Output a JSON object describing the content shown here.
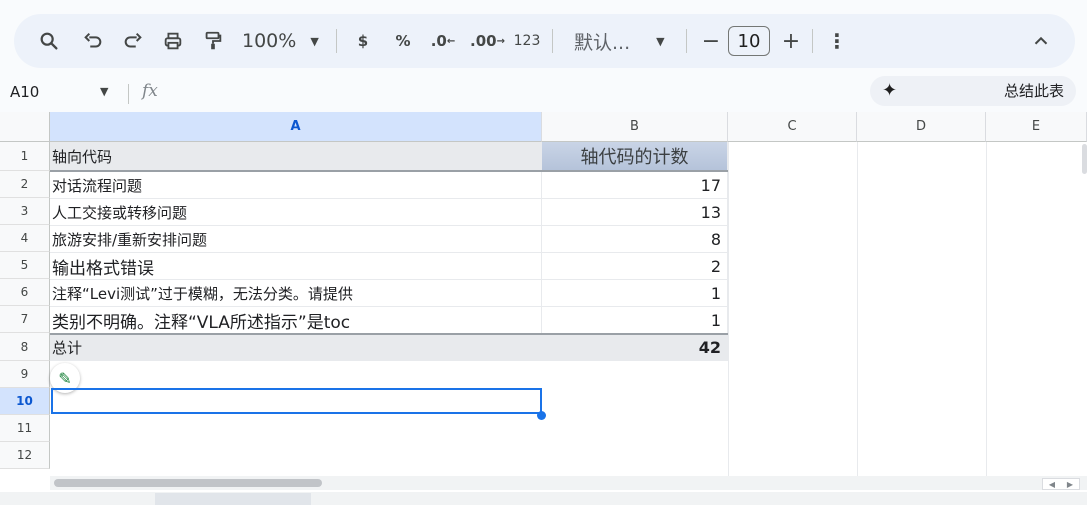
{
  "toolbar": {
    "zoom": "100%",
    "currency": "$",
    "percent": "%",
    "dec_decrease": ".0",
    "dec_increase": ".00",
    "format_123": "123",
    "font": "默认...",
    "minus": "−",
    "font_size": "10",
    "plus": "+",
    "more": "⋮",
    "collapse": "︿"
  },
  "formula_bar": {
    "cell_ref": "A10",
    "fx": "fx",
    "summarize_label": "总结此表"
  },
  "columns": [
    "A",
    "B",
    "C",
    "D",
    "E"
  ],
  "rows": [
    "1",
    "2",
    "3",
    "4",
    "5",
    "6",
    "7",
    "8",
    "9",
    "10",
    "11",
    "12"
  ],
  "table": {
    "header_a": "轴向代码",
    "header_b": "轴代码的计数",
    "items": [
      {
        "label": "对话流程问题",
        "count": "17"
      },
      {
        "label": "人工交接或转移问题",
        "count": "13"
      },
      {
        "label": "旅游安排/重新安排问题",
        "count": "8"
      },
      {
        "label": "输出格式错误",
        "count": "2"
      },
      {
        "label": "注释“Levi测试”过于模糊，无法分类。请提供",
        "count": "1"
      },
      {
        "label": "类别不明确。注释“VLA所述指示”是toc",
        "count": "1"
      }
    ],
    "total_label": "总计",
    "total_value": "42"
  },
  "colors": {
    "toolbar_bg": "#edf2fa",
    "selection": "#1a73e8",
    "header_selected": "#d3e3fd"
  }
}
